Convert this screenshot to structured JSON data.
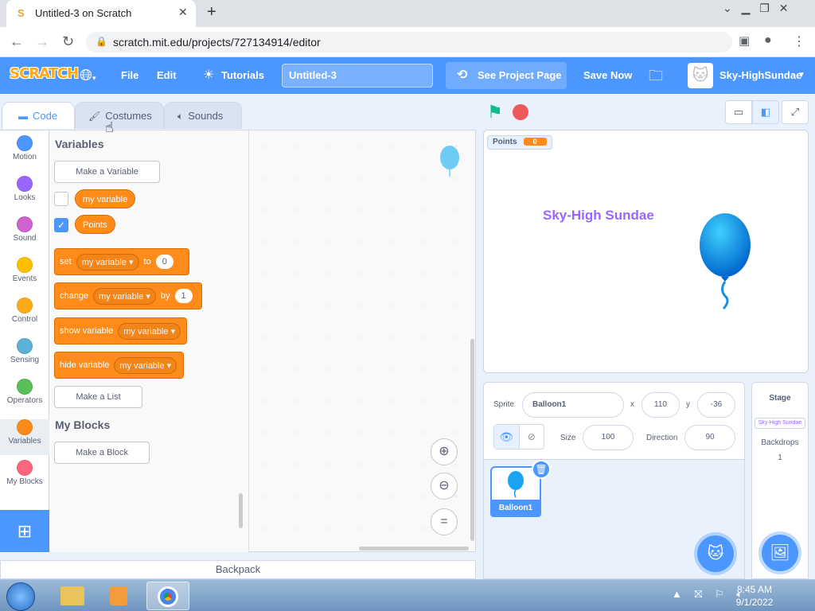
{
  "browser": {
    "tab_title": "Untitled-3 on Scratch",
    "url": "scratch.mit.edu/projects/727134914/editor"
  },
  "menu": {
    "logo": "SCRATCH",
    "file": "File",
    "edit": "Edit",
    "tutorials": "Tutorials",
    "project_title": "Untitled-3",
    "see_project_page": "See Project Page",
    "save_now": "Save Now",
    "username": "Sky-HighSundae"
  },
  "tabs": {
    "code": "Code",
    "costumes": "Costumes",
    "sounds": "Sounds"
  },
  "categories": [
    {
      "label": "Motion",
      "color": "#4c97ff"
    },
    {
      "label": "Looks",
      "color": "#9966ff"
    },
    {
      "label": "Sound",
      "color": "#cf63cf"
    },
    {
      "label": "Events",
      "color": "#ffbf00"
    },
    {
      "label": "Control",
      "color": "#ffab19"
    },
    {
      "label": "Sensing",
      "color": "#5cb1d6"
    },
    {
      "label": "Operators",
      "color": "#59c059"
    },
    {
      "label": "Variables",
      "color": "#ff8c1a"
    },
    {
      "label": "My Blocks",
      "color": "#ff6680"
    }
  ],
  "palette": {
    "variables_heading": "Variables",
    "make_variable": "Make a Variable",
    "var1": "my variable",
    "var2": "Points",
    "set_block": {
      "kw": "set",
      "var": "my variable",
      "to": "to",
      "val": "0"
    },
    "change_block": {
      "kw": "change",
      "var": "my variable",
      "by": "by",
      "val": "1"
    },
    "show_block": {
      "kw": "show variable",
      "var": "my variable"
    },
    "hide_block": {
      "kw": "hide variable",
      "var": "my variable"
    },
    "make_list": "Make a List",
    "myblocks_heading": "My Blocks",
    "make_block": "Make a Block"
  },
  "backpack": "Backpack",
  "stage": {
    "monitor_label": "Points",
    "monitor_value": "0",
    "text": "Sky-High Sundae"
  },
  "sprite_info": {
    "sprite_label": "Sprite",
    "sprite_name": "Balloon1",
    "x_label": "x",
    "x": "110",
    "y_label": "y",
    "y": "-36",
    "size_label": "Size",
    "size": "100",
    "direction_label": "Direction",
    "direction": "90"
  },
  "sprites": [
    {
      "name": "Balloon1"
    }
  ],
  "stage_panel": {
    "title": "Stage",
    "thumb_text": "Sky-High Sundae",
    "backdrops_label": "Backdrops",
    "backdrops_count": "1"
  },
  "taskbar": {
    "time": "8:45 AM",
    "date": "9/1/2022"
  }
}
